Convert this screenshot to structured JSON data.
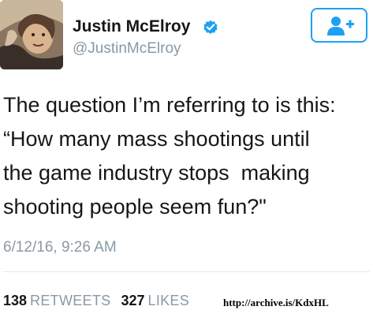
{
  "author": {
    "display_name": "Justin McElroy",
    "handle": "@JustinMcElroy",
    "verified": true,
    "avatar_icon": "profile-photo"
  },
  "follow_button": {
    "icon": "follow-user-plus-icon",
    "color": "#1da1f2"
  },
  "tweet": {
    "lines": [
      "The question I’m referring to is this:",
      "“How many mass shootings until",
      "the game industry stops  making",
      "shooting people seem fun?\""
    ],
    "timestamp": "6/12/16, 9:26 AM"
  },
  "stats": {
    "retweets_count": "138",
    "retweets_label": "RETWEETS",
    "likes_count": "327",
    "likes_label": "LIKES"
  },
  "archive_url": "http://archive.is/KdxHL",
  "colors": {
    "accent": "#1da1f2",
    "muted": "#8899a6",
    "text": "#14171a"
  }
}
